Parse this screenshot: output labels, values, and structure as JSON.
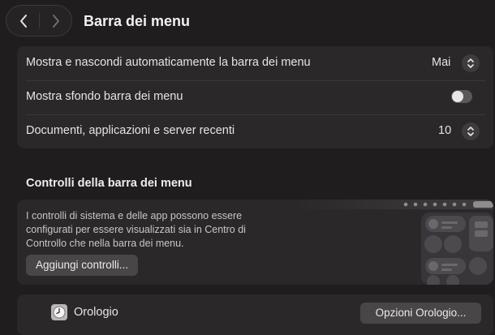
{
  "window": {
    "title": "Barra dei menu"
  },
  "settings": [
    {
      "label": "Mostra e nascondi automaticamente la barra dei menu",
      "value": "Mai",
      "control": "stepper"
    },
    {
      "label": "Mostra sfondo barra dei menu",
      "control": "toggle",
      "on": false
    },
    {
      "label": "Documenti, applicazioni e server recenti",
      "value": "10",
      "control": "stepper"
    }
  ],
  "controls_section": {
    "title": "Controlli della barra dei menu",
    "description": "I controlli di sistema e delle app possono essere configurati per essere visualizzati sia in Centro di Controllo che nella barra dei menu.",
    "add_button": "Aggiungi controlli..."
  },
  "clock": {
    "label": "Orologio",
    "options_button": "Opzioni Orologio..."
  },
  "colors": {
    "background": "#1f1d1e",
    "panel": "#2a2829",
    "button": "#484647"
  },
  "icons": [
    "chevron-left-icon",
    "chevron-right-icon",
    "chevron-up-down-icon",
    "clock-icon"
  ]
}
